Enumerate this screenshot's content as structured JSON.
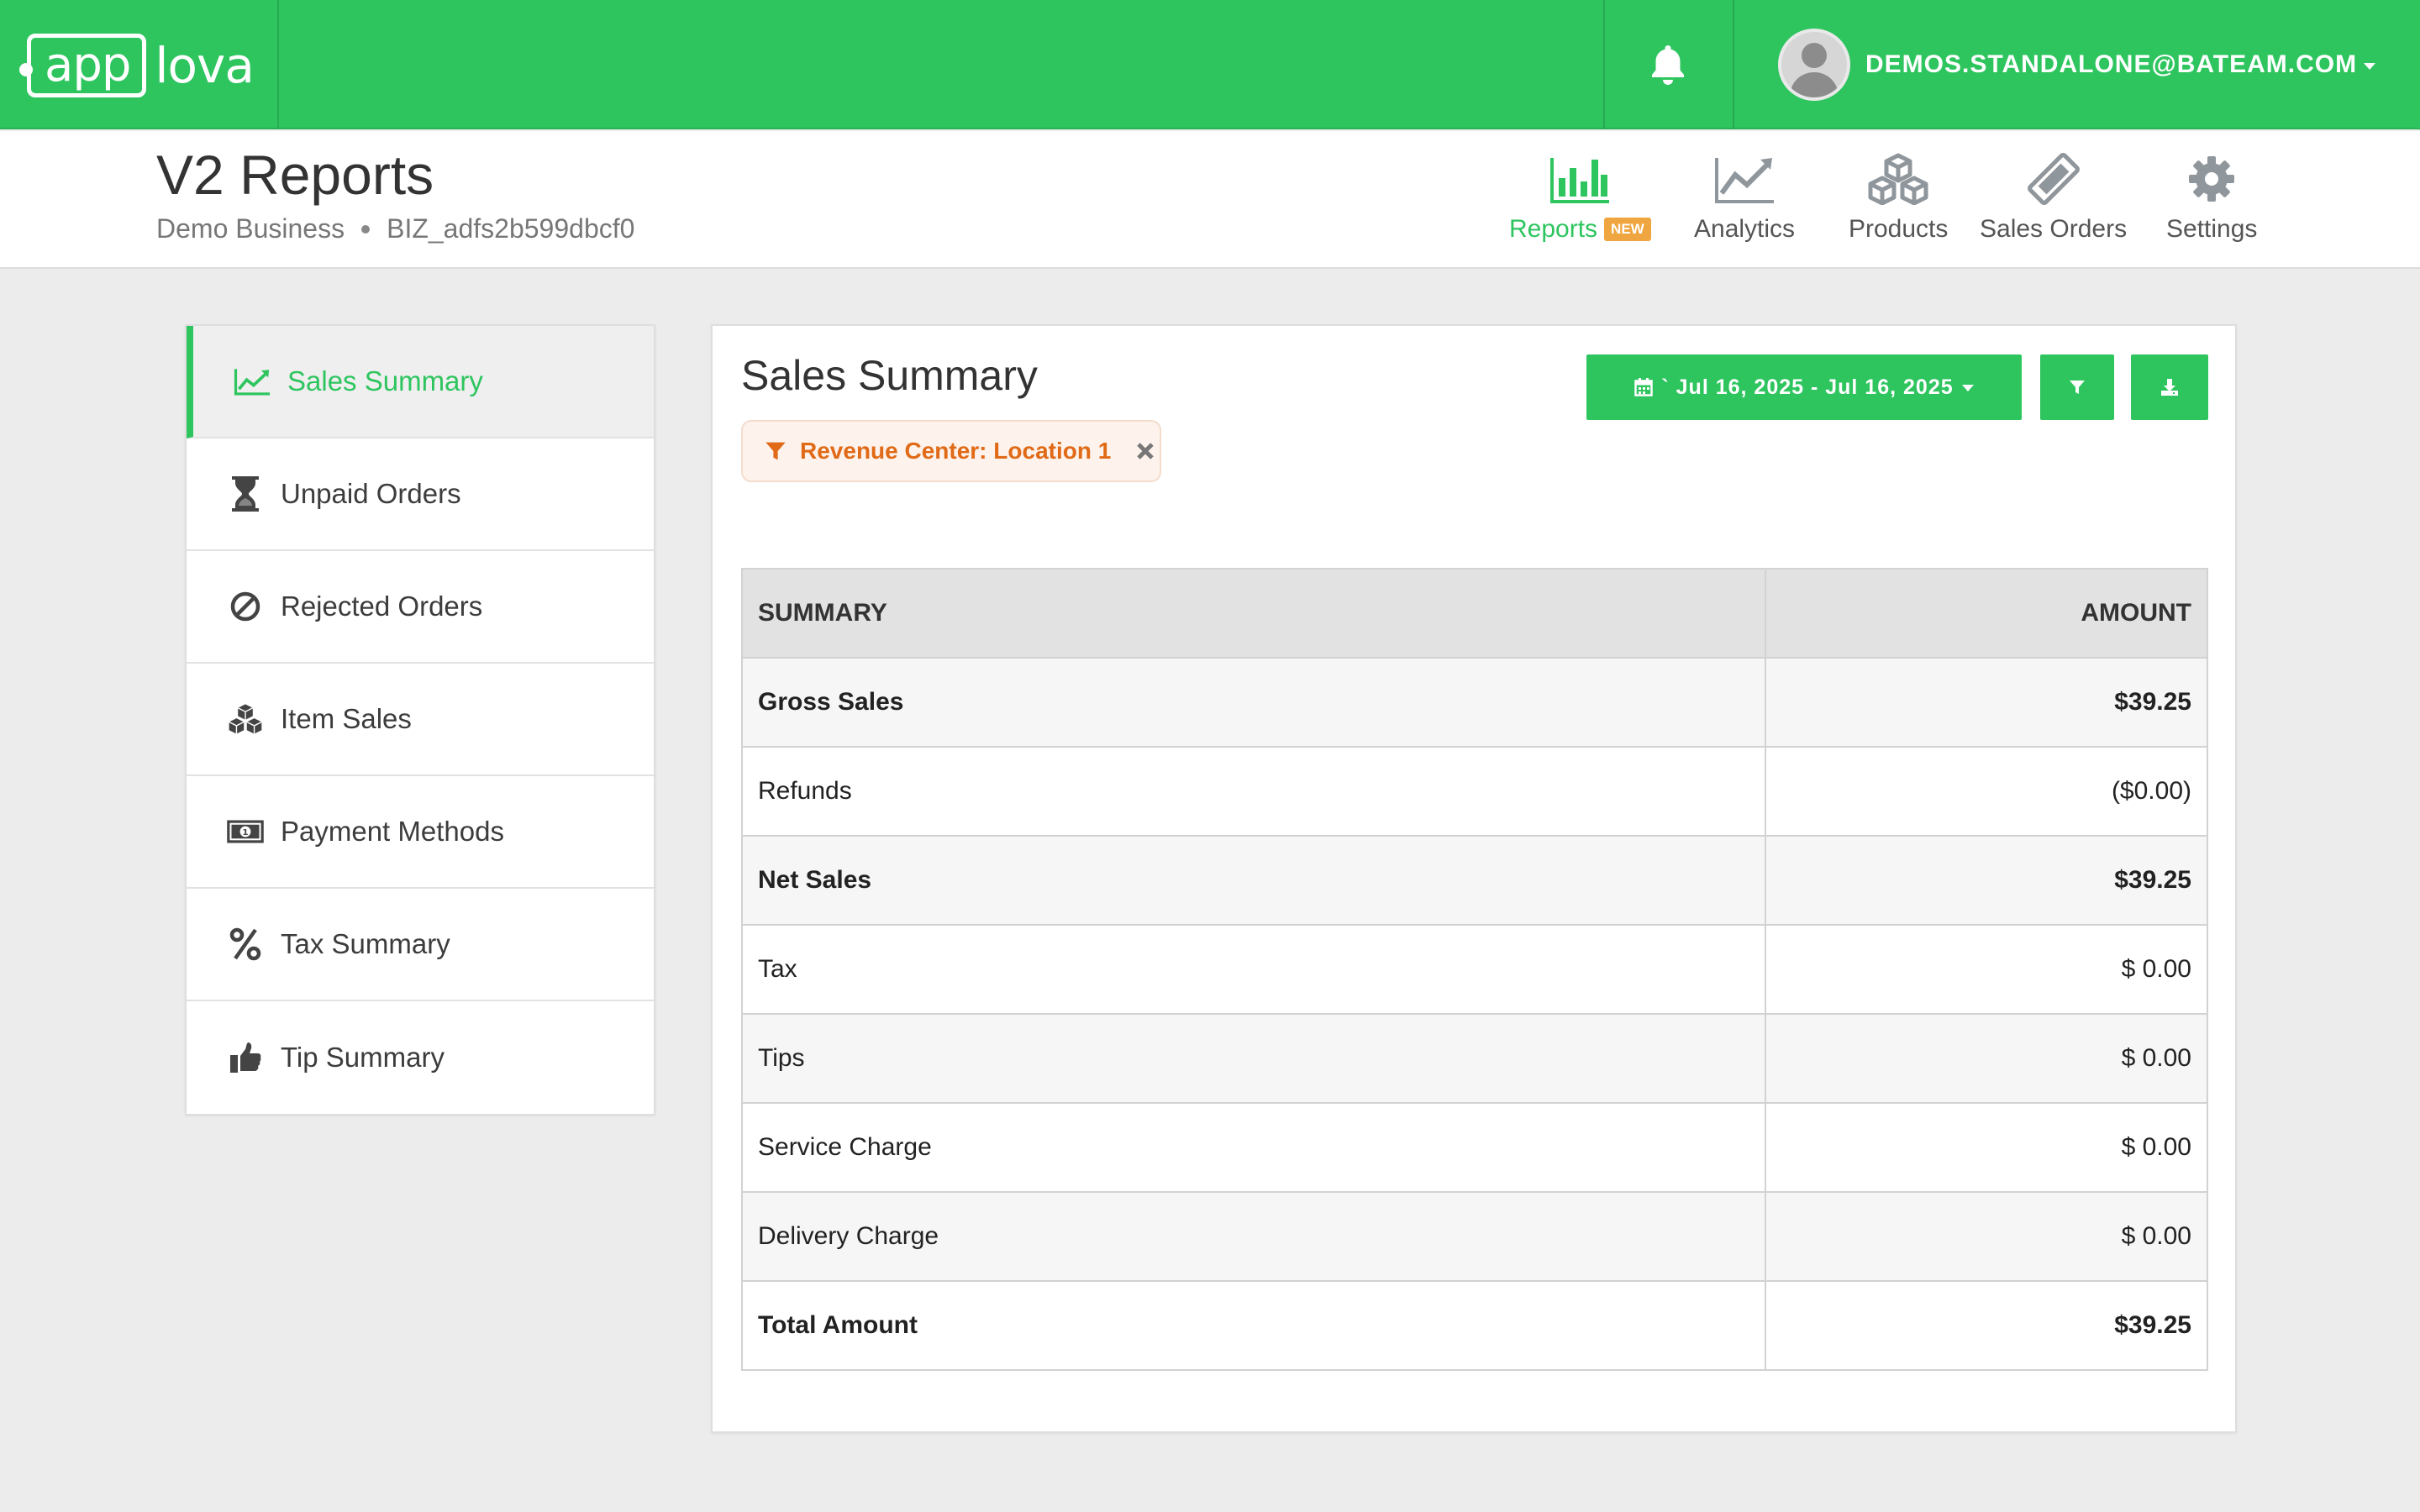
{
  "brand": {
    "logo_app": "app",
    "logo_lova": "lova"
  },
  "topbar": {
    "user_email": "DEMOS.STANDALONE@BATEAM.COM",
    "icons": {
      "bell": "bell-icon",
      "avatar": "user-avatar-icon"
    }
  },
  "header": {
    "title": "V2 Reports",
    "business": "Demo Business",
    "business_id": "BIZ_adfs2b599dbcf0"
  },
  "nav": [
    {
      "label": "Reports",
      "badge": "NEW",
      "icon": "bar-chart-icon",
      "active": true
    },
    {
      "label": "Analytics",
      "icon": "line-chart-icon"
    },
    {
      "label": "Products",
      "icon": "cubes-icon"
    },
    {
      "label": "Sales Orders",
      "icon": "ticket-icon"
    },
    {
      "label": "Settings",
      "icon": "gear-icon"
    }
  ],
  "sidebar": {
    "items": [
      {
        "label": "Sales Summary",
        "icon": "line-chart-icon",
        "active": true
      },
      {
        "label": "Unpaid Orders",
        "icon": "hourglass-icon"
      },
      {
        "label": "Rejected Orders",
        "icon": "ban-icon"
      },
      {
        "label": "Item Sales",
        "icon": "cubes-icon"
      },
      {
        "label": "Payment Methods",
        "icon": "money-icon"
      },
      {
        "label": "Tax Summary",
        "icon": "percent-icon"
      },
      {
        "label": "Tip Summary",
        "icon": "thumbs-up-icon"
      }
    ]
  },
  "main": {
    "title": "Sales Summary",
    "date_range": "` Jul 16, 2025 - Jul 16, 2025",
    "filter_chip": "Revenue Center: Location 1",
    "table": {
      "headers": {
        "summary": "SUMMARY",
        "amount": "AMOUNT"
      },
      "rows": [
        {
          "label": "Gross Sales",
          "amount": "$39.25",
          "bold": true
        },
        {
          "label": "Refunds",
          "amount": "($0.00)",
          "bold": false
        },
        {
          "label": "Net Sales",
          "amount": "$39.25",
          "bold": true
        },
        {
          "label": "Tax",
          "amount": "$ 0.00",
          "bold": false
        },
        {
          "label": "Tips",
          "amount": "$ 0.00",
          "bold": false
        },
        {
          "label": "Service Charge",
          "amount": "$ 0.00",
          "bold": false
        },
        {
          "label": "Delivery Charge",
          "amount": "$ 0.00",
          "bold": false
        },
        {
          "label": "Total Amount",
          "amount": "$39.25",
          "bold": true
        }
      ]
    }
  },
  "colors": {
    "brand_green": "#2ec55f",
    "badge_orange": "#f0a640",
    "chip_orange": "#e06a17"
  }
}
